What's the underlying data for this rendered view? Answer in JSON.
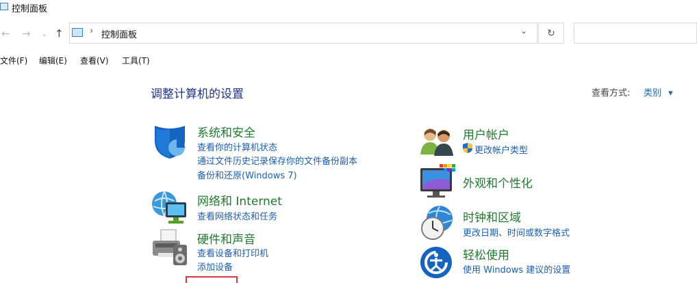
{
  "window": {
    "title": "控制面板"
  },
  "address": {
    "path": "控制面板",
    "separator": "›",
    "dropdown_glyph": "⌄",
    "refresh_glyph": "↻"
  },
  "nav": {
    "back": "←",
    "forward": "→",
    "recent": "⌄",
    "up": "↑"
  },
  "menu": [
    "文件(F)",
    "编辑(E)",
    "查看(V)",
    "工具(T)"
  ],
  "page": {
    "title": "调整计算机的设置",
    "view_by_label": "查看方式:",
    "view_by_value": "类别",
    "view_by_arrow": "▾"
  },
  "categories_left": [
    {
      "name": "系统和安全",
      "icon": "shield-icon",
      "links": [
        "查看你的计算机状态",
        "通过文件历史记录保存你的文件备份副本",
        "备份和还原(Windows 7)"
      ]
    },
    {
      "name": "网络和 Internet",
      "icon": "network-icon",
      "links": [
        "查看网络状态和任务"
      ]
    },
    {
      "name": "硬件和声音",
      "icon": "printer-icon",
      "links": [
        "查看设备和打印机",
        "添加设备"
      ]
    }
  ],
  "categories_right": [
    {
      "name": "用户帐户",
      "icon": "users-icon",
      "links": [
        "更改帐户类型"
      ]
    },
    {
      "name": "外观和个性化",
      "icon": "monitor-icon",
      "links": []
    },
    {
      "name": "时钟和区域",
      "icon": "clock-icon",
      "links": [
        "更改日期、时间或数字格式"
      ]
    },
    {
      "name": "轻松使用",
      "icon": "ease-of-access-icon",
      "links": [
        "使用 Windows 建议的设置"
      ]
    }
  ],
  "colors": {
    "category": "#1f7a2e",
    "link": "#1a5fb4",
    "title": "#1e3287",
    "highlight_box": "#d9363e"
  }
}
